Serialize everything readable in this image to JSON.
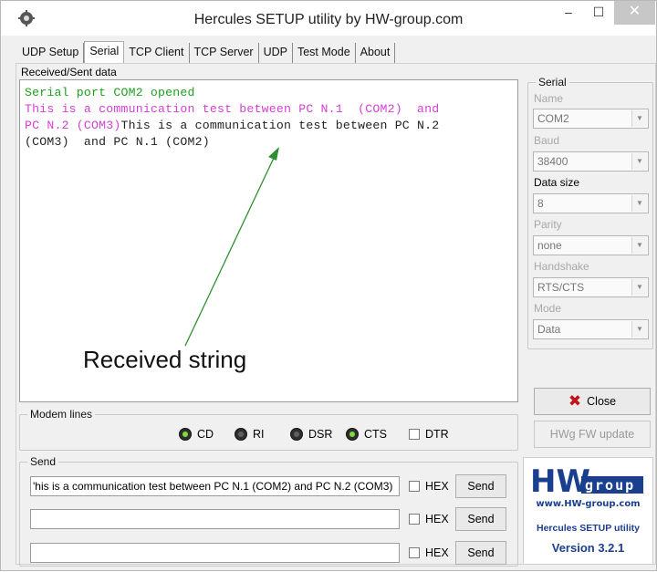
{
  "window": {
    "title": "Hercules SETUP utility by HW-group.com",
    "minimize": "–",
    "maximize": "☐",
    "close": "✕"
  },
  "tabs": [
    "UDP Setup",
    "Serial",
    "TCP Client",
    "TCP Server",
    "UDP",
    "Test Mode",
    "About"
  ],
  "active_tab": "Serial",
  "received": {
    "label": "Received/Sent data",
    "line1": "Serial port COM2 opened",
    "line2_magenta": "This is a communication test between PC N.1  (COM2)  and",
    "line3_magenta": "PC N.2 (COM3)",
    "line3_dark": "This is a communication test between PC N.2",
    "line4_dark": "(COM3)  and PC N.1 (COM2)"
  },
  "annotation": {
    "text": "Received string"
  },
  "modem": {
    "label": "Modem lines",
    "cd": "CD",
    "ri": "RI",
    "dsr": "DSR",
    "cts": "CTS",
    "dtr": "DTR"
  },
  "send": {
    "label": "Send",
    "input1": "'his is a communication test between PC N.1  (COM2)  and PC N.2 (COM3)",
    "input2": "",
    "input3": "",
    "hex": "HEX",
    "button": "Send"
  },
  "serial": {
    "group_label": "Serial",
    "name_label": "Name",
    "name_value": "COM2",
    "baud_label": "Baud",
    "baud_value": "38400",
    "datasize_label": "Data size",
    "datasize_value": "8",
    "parity_label": "Parity",
    "parity_value": "none",
    "handshake_label": "Handshake",
    "handshake_value": "RTS/CTS",
    "mode_label": "Mode",
    "mode_value": "Data"
  },
  "buttons": {
    "close": "Close",
    "fw_update": "HWg FW update"
  },
  "logo": {
    "hw": "HW",
    "group": "group",
    "url": "www.HW-group.com",
    "name": "Hercules SETUP utility",
    "version": "Version  3.2.1"
  },
  "colors": {
    "green_text": "#1ea11e",
    "magenta_text": "#d43fd4",
    "arrow": "#2f8f2f",
    "logo_blue": "#1b3f8f",
    "close_red": "#c0141a"
  }
}
